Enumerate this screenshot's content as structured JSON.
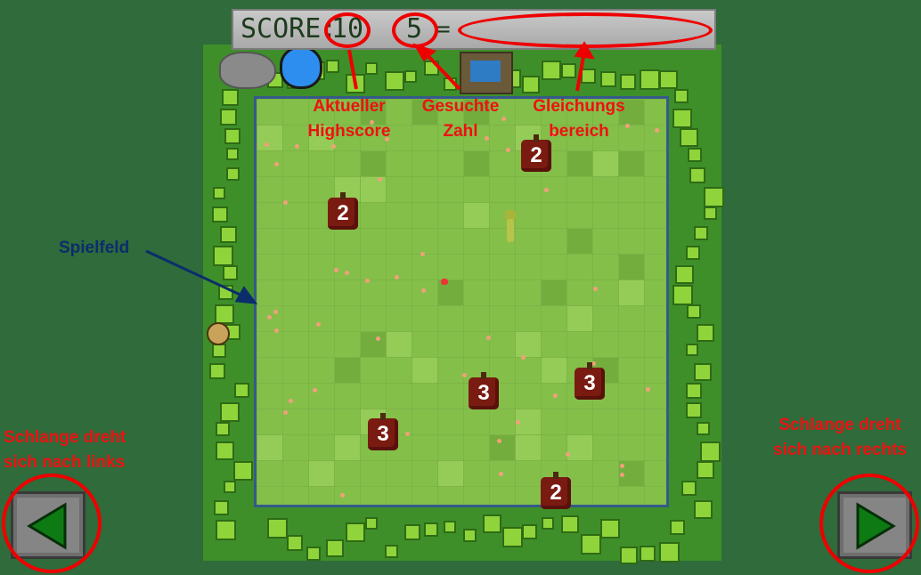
{
  "hud": {
    "score_label": "SCORE:",
    "score_value": "10",
    "target_value": "5",
    "equals": "="
  },
  "annotations": {
    "highscore": [
      "Aktueller",
      "Highscore"
    ],
    "target": [
      "Gesuchte",
      "Zahl"
    ],
    "equation": [
      "Gleichungs",
      "bereich"
    ],
    "field": "Spielfeld",
    "left": [
      "Schlange dreht",
      "sich nach links"
    ],
    "right": [
      "Schlange dreht",
      "sich nach rechts"
    ]
  },
  "apples": [
    "2",
    "2",
    "3",
    "3",
    "3",
    "2"
  ],
  "controls": {
    "left_icon": "arrow-left-icon",
    "right_icon": "arrow-right-icon"
  },
  "colors": {
    "annotation": "#ee1111",
    "field_border": "#355a8a",
    "lcd_text": "#1d3b1d"
  }
}
